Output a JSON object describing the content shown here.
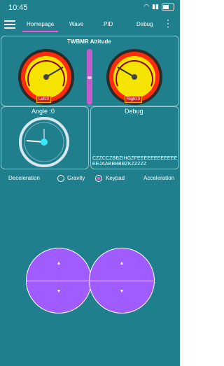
{
  "status": {
    "time": "10:45",
    "battery": "37"
  },
  "tabs": [
    "Homepage",
    "Wave",
    "PID",
    "Debug"
  ],
  "panel_title": "TWBMR Attitude",
  "left_label": "Left:0",
  "right_label": "Right:0",
  "angle_label": "Angle :0",
  "debug_label": "Debug",
  "debug_text": "CZZCCZBBZIHGZFEEEEEEEEEEEEEEJAABBBBBZKZZZZZ",
  "deceleration": "Deceleration",
  "gravity": "Gravity",
  "keypad": "Keypad",
  "acceleration": "Acceleration",
  "selected_mode": "Keypad"
}
